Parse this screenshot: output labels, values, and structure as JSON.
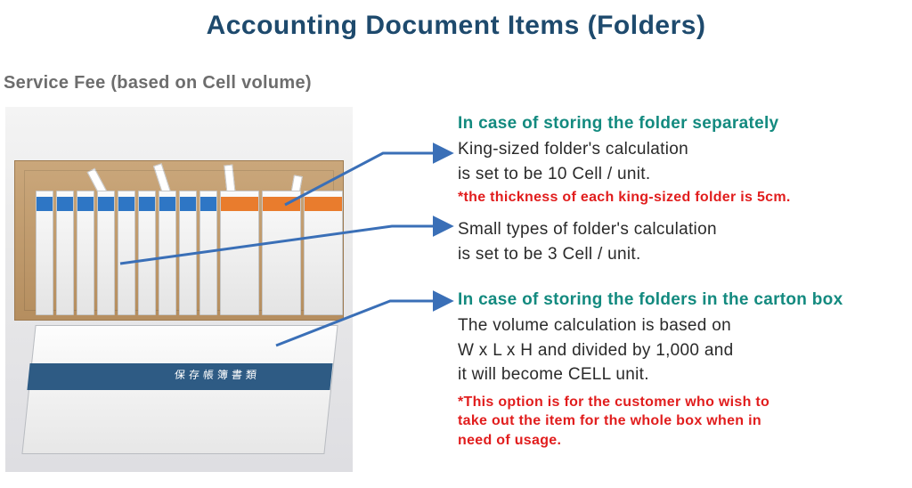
{
  "title": "Accounting Document Items (Folders)",
  "subtitle": "Service Fee (based on Cell volume)",
  "illustration": {
    "box_label": "保存帳簿書類",
    "folders_in_box": 12,
    "wide_folders": 3
  },
  "sections": {
    "separate": {
      "heading": "In case of storing the folder separately",
      "king_line1": "King-sized folder's calculation",
      "king_line2": "is set to be 10 Cell / unit.",
      "king_note": "*the thickness of each king-sized folder is 5cm.",
      "small_line1": "Small types of folder's calculation",
      "small_line2": "is set to be 3 Cell / unit."
    },
    "carton": {
      "heading": "In case of storing the folders in the carton box",
      "body_line1": "The volume calculation is based on",
      "body_line2": "W x L x H and divided by 1,000 and",
      "body_line3": "it will become CELL unit.",
      "note_line1": "*This option is for the customer who wish to",
      "note_line2": "take out the item for the whole box when in",
      "note_line3": "need of usage."
    }
  },
  "colors": {
    "title": "#1e4a6d",
    "heading": "#138a7f",
    "note": "#e11d1d",
    "arrow": "#3a6fb7"
  }
}
